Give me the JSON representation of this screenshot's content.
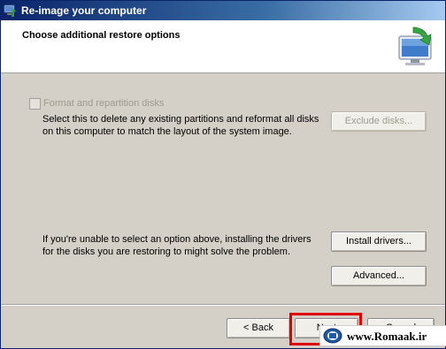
{
  "window": {
    "title": "Re-image your computer",
    "heading": "Choose additional restore options"
  },
  "format_option": {
    "checkbox_label": "Format and repartition disks",
    "checked": false,
    "enabled": false,
    "description_line1": "Select this to delete any existing partitions and reformat all disks",
    "description_line2": "on this computer to match the layout of the system image.",
    "exclude_button": "Exclude disks..."
  },
  "drivers": {
    "description_line1": "If you're unable to select an option above, installing the drivers",
    "description_line2": "for the disks you are restoring to might solve the problem.",
    "install_button": "Install drivers..."
  },
  "advanced_button": "Advanced...",
  "footer": {
    "back_button": "< Back",
    "next_button": "Next",
    "cancel_button": "Cancel"
  },
  "watermark": {
    "text": "www.Romaak.ir"
  },
  "colors": {
    "dialog_bg": "#d4d0c8",
    "titlebar": "#0a246a",
    "highlight": "#e00000",
    "disabled_text": "#a09a8e"
  }
}
